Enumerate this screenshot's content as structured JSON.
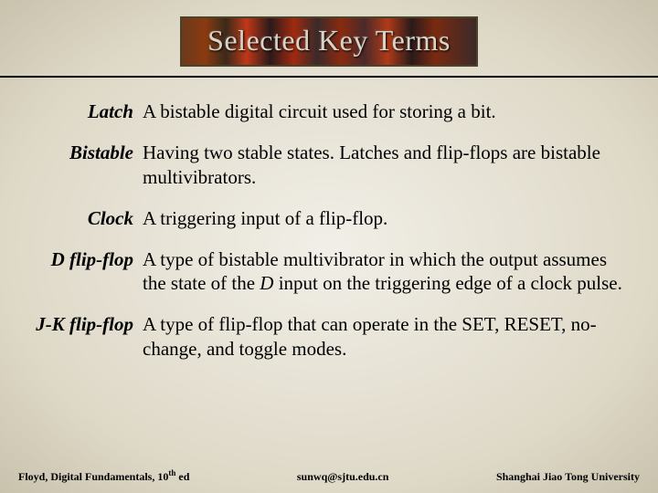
{
  "title": "Selected Key Terms",
  "terms": [
    {
      "label": "Latch",
      "def": "A bistable digital circuit used for storing a bit."
    },
    {
      "label": "Bistable",
      "def": "Having two stable states. Latches and flip-flops are bistable multivibrators."
    },
    {
      "label": "Clock",
      "def": "A triggering input of a flip-flop."
    },
    {
      "label": "D flip-flop",
      "def_html": "A type of bistable multivibrator in which the output assumes the state of the <span class=\"d-ital\">D</span> input on the triggering edge of a clock pulse."
    },
    {
      "label": "J-K flip-flop",
      "def": "A type of flip-flop that can operate in the SET, RESET, no-change, and toggle modes."
    }
  ],
  "footer": {
    "left_html": "Floyd, Digital Fundamentals, 10<span class=\"ordinal\">th</span> ed",
    "center": "sunwq@sjtu.edu.cn",
    "right": "Shanghai Jiao Tong University"
  }
}
